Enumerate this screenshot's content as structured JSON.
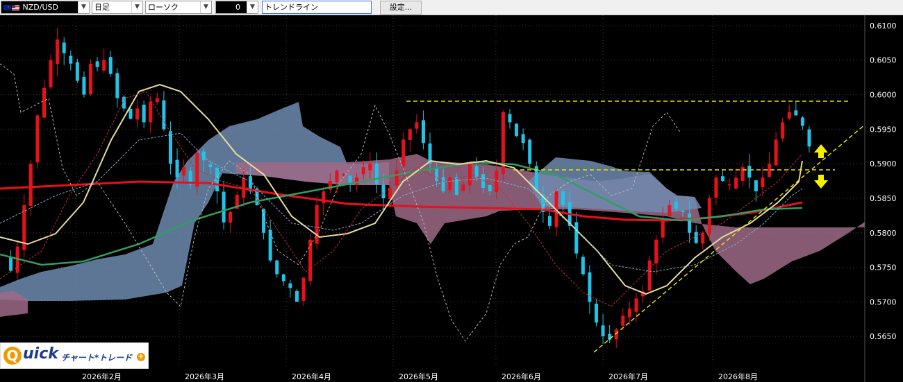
{
  "toolbar": {
    "symbol": "NZD/USD",
    "timeframe": "日足",
    "chart_type": "ローソク",
    "tool_select": "0",
    "drawing_tool": "トレンドライン",
    "settings_label": "設定..."
  },
  "logo": {
    "text": "Quick チャート*トレード"
  },
  "chart_data": {
    "type": "candlestick",
    "symbol": "NZD/USD",
    "timeframe": "daily",
    "y_ticks": [
      "0.6100",
      "0.6050",
      "0.6000",
      "0.5950",
      "0.5900",
      "0.5850",
      "0.5800",
      "0.5750",
      "0.5700",
      "0.5650"
    ],
    "ylim": [
      0.5605,
      0.6115
    ],
    "x_labels": [
      "2026年2月",
      "2026年3月",
      "2026年4月",
      "2026年5月",
      "2026年6月",
      "2026年7月",
      "2026年8月"
    ],
    "colors": {
      "up_candle": "#e8101a",
      "down_candle": "#21c4e8",
      "moving_average_long": "#e8101a",
      "moving_average_mid": "#2f9e63",
      "moving_average_short": "#e8dca0",
      "kumo_bull": "#6e8bb0",
      "kumo_bear": "#9e6a86",
      "trendline": "#e8e000",
      "arrow": "#f5f000"
    },
    "price_path": [
      0.5765,
      0.5745,
      0.578,
      0.584,
      0.59,
      0.597,
      0.601,
      0.605,
      0.608,
      0.606,
      0.6045,
      0.602,
      0.6,
      0.6045,
      0.604,
      0.605,
      0.603,
      0.5995,
      0.598,
      0.5965,
      0.598,
      0.596,
      0.599,
      0.5995,
      0.595,
      0.59,
      0.588,
      0.5895,
      0.587,
      0.5915,
      0.5905,
      0.5895,
      0.586,
      0.5815,
      0.583,
      0.5855,
      0.588,
      0.586,
      0.584,
      0.58,
      0.576,
      0.574,
      0.573,
      0.572,
      0.57,
      0.5735,
      0.579,
      0.584,
      0.586,
      0.5875,
      0.589,
      0.5885,
      0.587,
      0.588,
      0.5895,
      0.59,
      0.587,
      0.585,
      0.5865,
      0.589,
      0.5935,
      0.595,
      0.596,
      0.593,
      0.59,
      0.5875,
      0.586,
      0.588,
      0.5855,
      0.587,
      0.59,
      0.588,
      0.5865,
      0.586,
      0.589,
      0.5975,
      0.596,
      0.594,
      0.593,
      0.59,
      0.586,
      0.583,
      0.581,
      0.586,
      0.584,
      0.581,
      0.577,
      0.574,
      0.57,
      0.567,
      0.565,
      0.5645,
      0.566,
      0.568,
      0.569,
      0.5705,
      0.5715,
      0.576,
      0.579,
      0.582,
      0.584,
      0.5835,
      0.583,
      0.58,
      0.5785,
      0.58,
      0.585,
      0.588,
      0.5875,
      0.587,
      0.588,
      0.5895,
      0.588,
      0.586,
      0.588,
      0.59,
      0.5935,
      0.596,
      0.5975,
      0.597,
      0.5955,
      0.5925
    ],
    "annotations": {
      "resistance_level": 0.599,
      "support_level": 0.589,
      "trendline_start": [
        0.5622,
        0.595
      ]
    }
  }
}
